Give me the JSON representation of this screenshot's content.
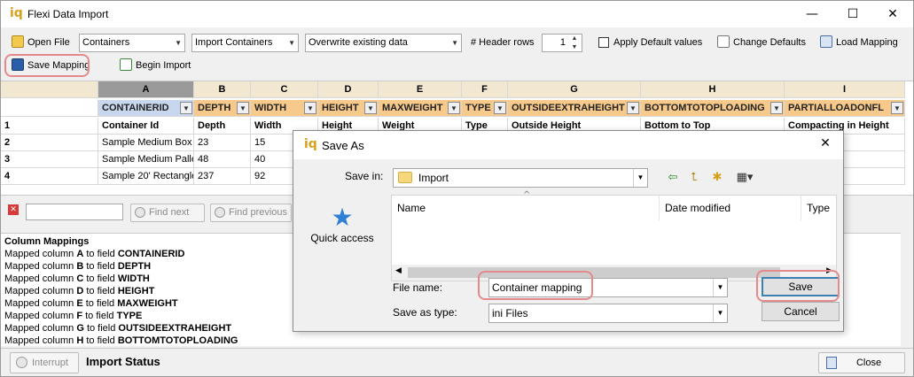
{
  "window": {
    "logo": "iq",
    "title": "Flexi Data Import",
    "minimize": "—",
    "maximize": "☐",
    "close": "✕"
  },
  "toolbar": {
    "open_file": "Open File",
    "object_combo": "Containers",
    "import_combo": "Import Containers",
    "mode_combo": "Overwrite existing data",
    "header_rows_label": "# Header rows",
    "header_rows_value": "1",
    "apply_defaults": "Apply Default values",
    "change_defaults": "Change Defaults",
    "load_mapping": "Load Mapping",
    "save_mapping": "Save Mapping",
    "begin_import": "Begin Import"
  },
  "grid": {
    "col_letters": [
      "A",
      "B",
      "C",
      "D",
      "E",
      "F",
      "G",
      "H",
      "I"
    ],
    "fields": [
      "CONTAINERID",
      "DEPTH",
      "WIDTH",
      "HEIGHT",
      "MAXWEIGHT",
      "TYPE",
      "OUTSIDEEXTRAHEIGHT",
      "BOTTOMTOTOPLOADING",
      "PARTIALLOADONFL"
    ],
    "rows": [
      {
        "num": "1",
        "cells": [
          "Container Id",
          "Depth",
          "Width",
          "Height",
          "Weight",
          "Type",
          "Outside Height",
          "Bottom to Top",
          "Compacting in Height"
        ]
      },
      {
        "num": "2",
        "cells": [
          "Sample Medium Box",
          "23",
          "15",
          "",
          "",
          "",
          "",
          "",
          ""
        ]
      },
      {
        "num": "3",
        "cells": [
          "Sample Medium Pallet",
          "48",
          "40",
          "",
          "",
          "",
          "",
          "",
          ""
        ]
      },
      {
        "num": "4",
        "cells": [
          "Sample 20' Rectangle",
          "237",
          "92",
          "",
          "",
          "",
          "",
          "",
          ""
        ]
      }
    ]
  },
  "search": {
    "find_next": "Find next",
    "find_previous": "Find previous"
  },
  "log": {
    "title": "Column Mappings",
    "lines": [
      {
        "prefix": "Mapped column ",
        "col": "A",
        "mid": " to field ",
        "field": "CONTAINERID"
      },
      {
        "prefix": "Mapped column ",
        "col": "B",
        "mid": " to field ",
        "field": "DEPTH"
      },
      {
        "prefix": "Mapped column ",
        "col": "C",
        "mid": " to field ",
        "field": "WIDTH"
      },
      {
        "prefix": "Mapped column ",
        "col": "D",
        "mid": " to field ",
        "field": "HEIGHT"
      },
      {
        "prefix": "Mapped column ",
        "col": "E",
        "mid": " to field ",
        "field": "MAXWEIGHT"
      },
      {
        "prefix": "Mapped column ",
        "col": "F",
        "mid": " to field ",
        "field": "TYPE"
      },
      {
        "prefix": "Mapped column ",
        "col": "G",
        "mid": " to field ",
        "field": "OUTSIDEEXTRAHEIGHT"
      },
      {
        "prefix": "Mapped column ",
        "col": "H",
        "mid": " to field ",
        "field": "BOTTOMTOTOPLOADING"
      }
    ]
  },
  "status": {
    "interrupt": "Interrupt",
    "import_status": "Import Status",
    "close": "Close"
  },
  "dialog": {
    "logo": "iq",
    "title": "Save As",
    "close": "✕",
    "save_in_label": "Save in:",
    "save_in_value": "Import",
    "quick_access": "Quick access",
    "col_name": "Name",
    "col_date": "Date modified",
    "col_type": "Type",
    "file_name_label": "File name:",
    "file_name_value": "Container mapping",
    "save_as_type_label": "Save as type:",
    "save_as_type_value": "ini Files",
    "save": "Save",
    "cancel": "Cancel"
  },
  "colors": {
    "highlight": "#e58a8a",
    "field_header": "#f7c98a",
    "selected_field": "#c9d7ee"
  }
}
